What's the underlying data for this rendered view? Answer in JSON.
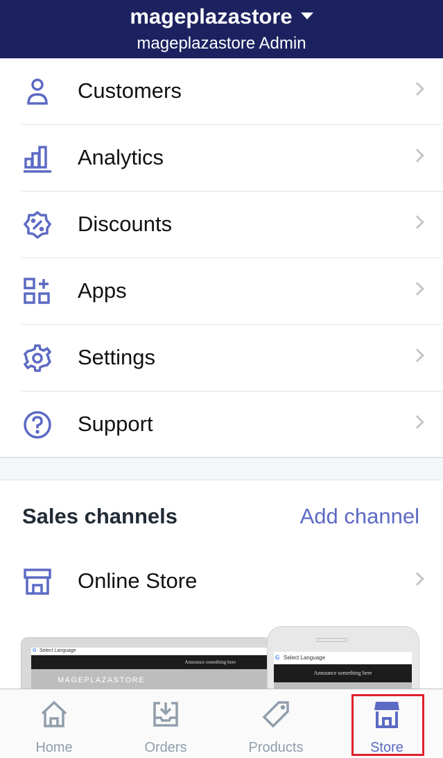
{
  "header": {
    "store_name": "mageplazastore",
    "subtitle": "mageplazastore Admin"
  },
  "menu": [
    {
      "label": "Customers",
      "icon": "customer-icon"
    },
    {
      "label": "Analytics",
      "icon": "analytics-icon"
    },
    {
      "label": "Discounts",
      "icon": "discount-icon"
    },
    {
      "label": "Apps",
      "icon": "apps-icon"
    },
    {
      "label": "Settings",
      "icon": "gear-icon"
    },
    {
      "label": "Support",
      "icon": "question-icon"
    }
  ],
  "sales_channels": {
    "title": "Sales channels",
    "add_label": "Add channel",
    "channels": [
      {
        "label": "Online Store",
        "icon": "store-icon"
      }
    ]
  },
  "preview": {
    "select_language": "Select Language",
    "announce": "Announce something here",
    "brand": "MAGEPLAZASTORE"
  },
  "tabs": [
    {
      "label": "Home",
      "icon": "home-icon",
      "active": false
    },
    {
      "label": "Orders",
      "icon": "inbox-icon",
      "active": false
    },
    {
      "label": "Products",
      "icon": "tag-icon",
      "active": false
    },
    {
      "label": "Store",
      "icon": "store-icon",
      "active": true
    }
  ],
  "colors": {
    "header": "#1c2260",
    "accent": "#5c6ac4",
    "inactive": "#919eab",
    "highlight": "#e0202a"
  }
}
